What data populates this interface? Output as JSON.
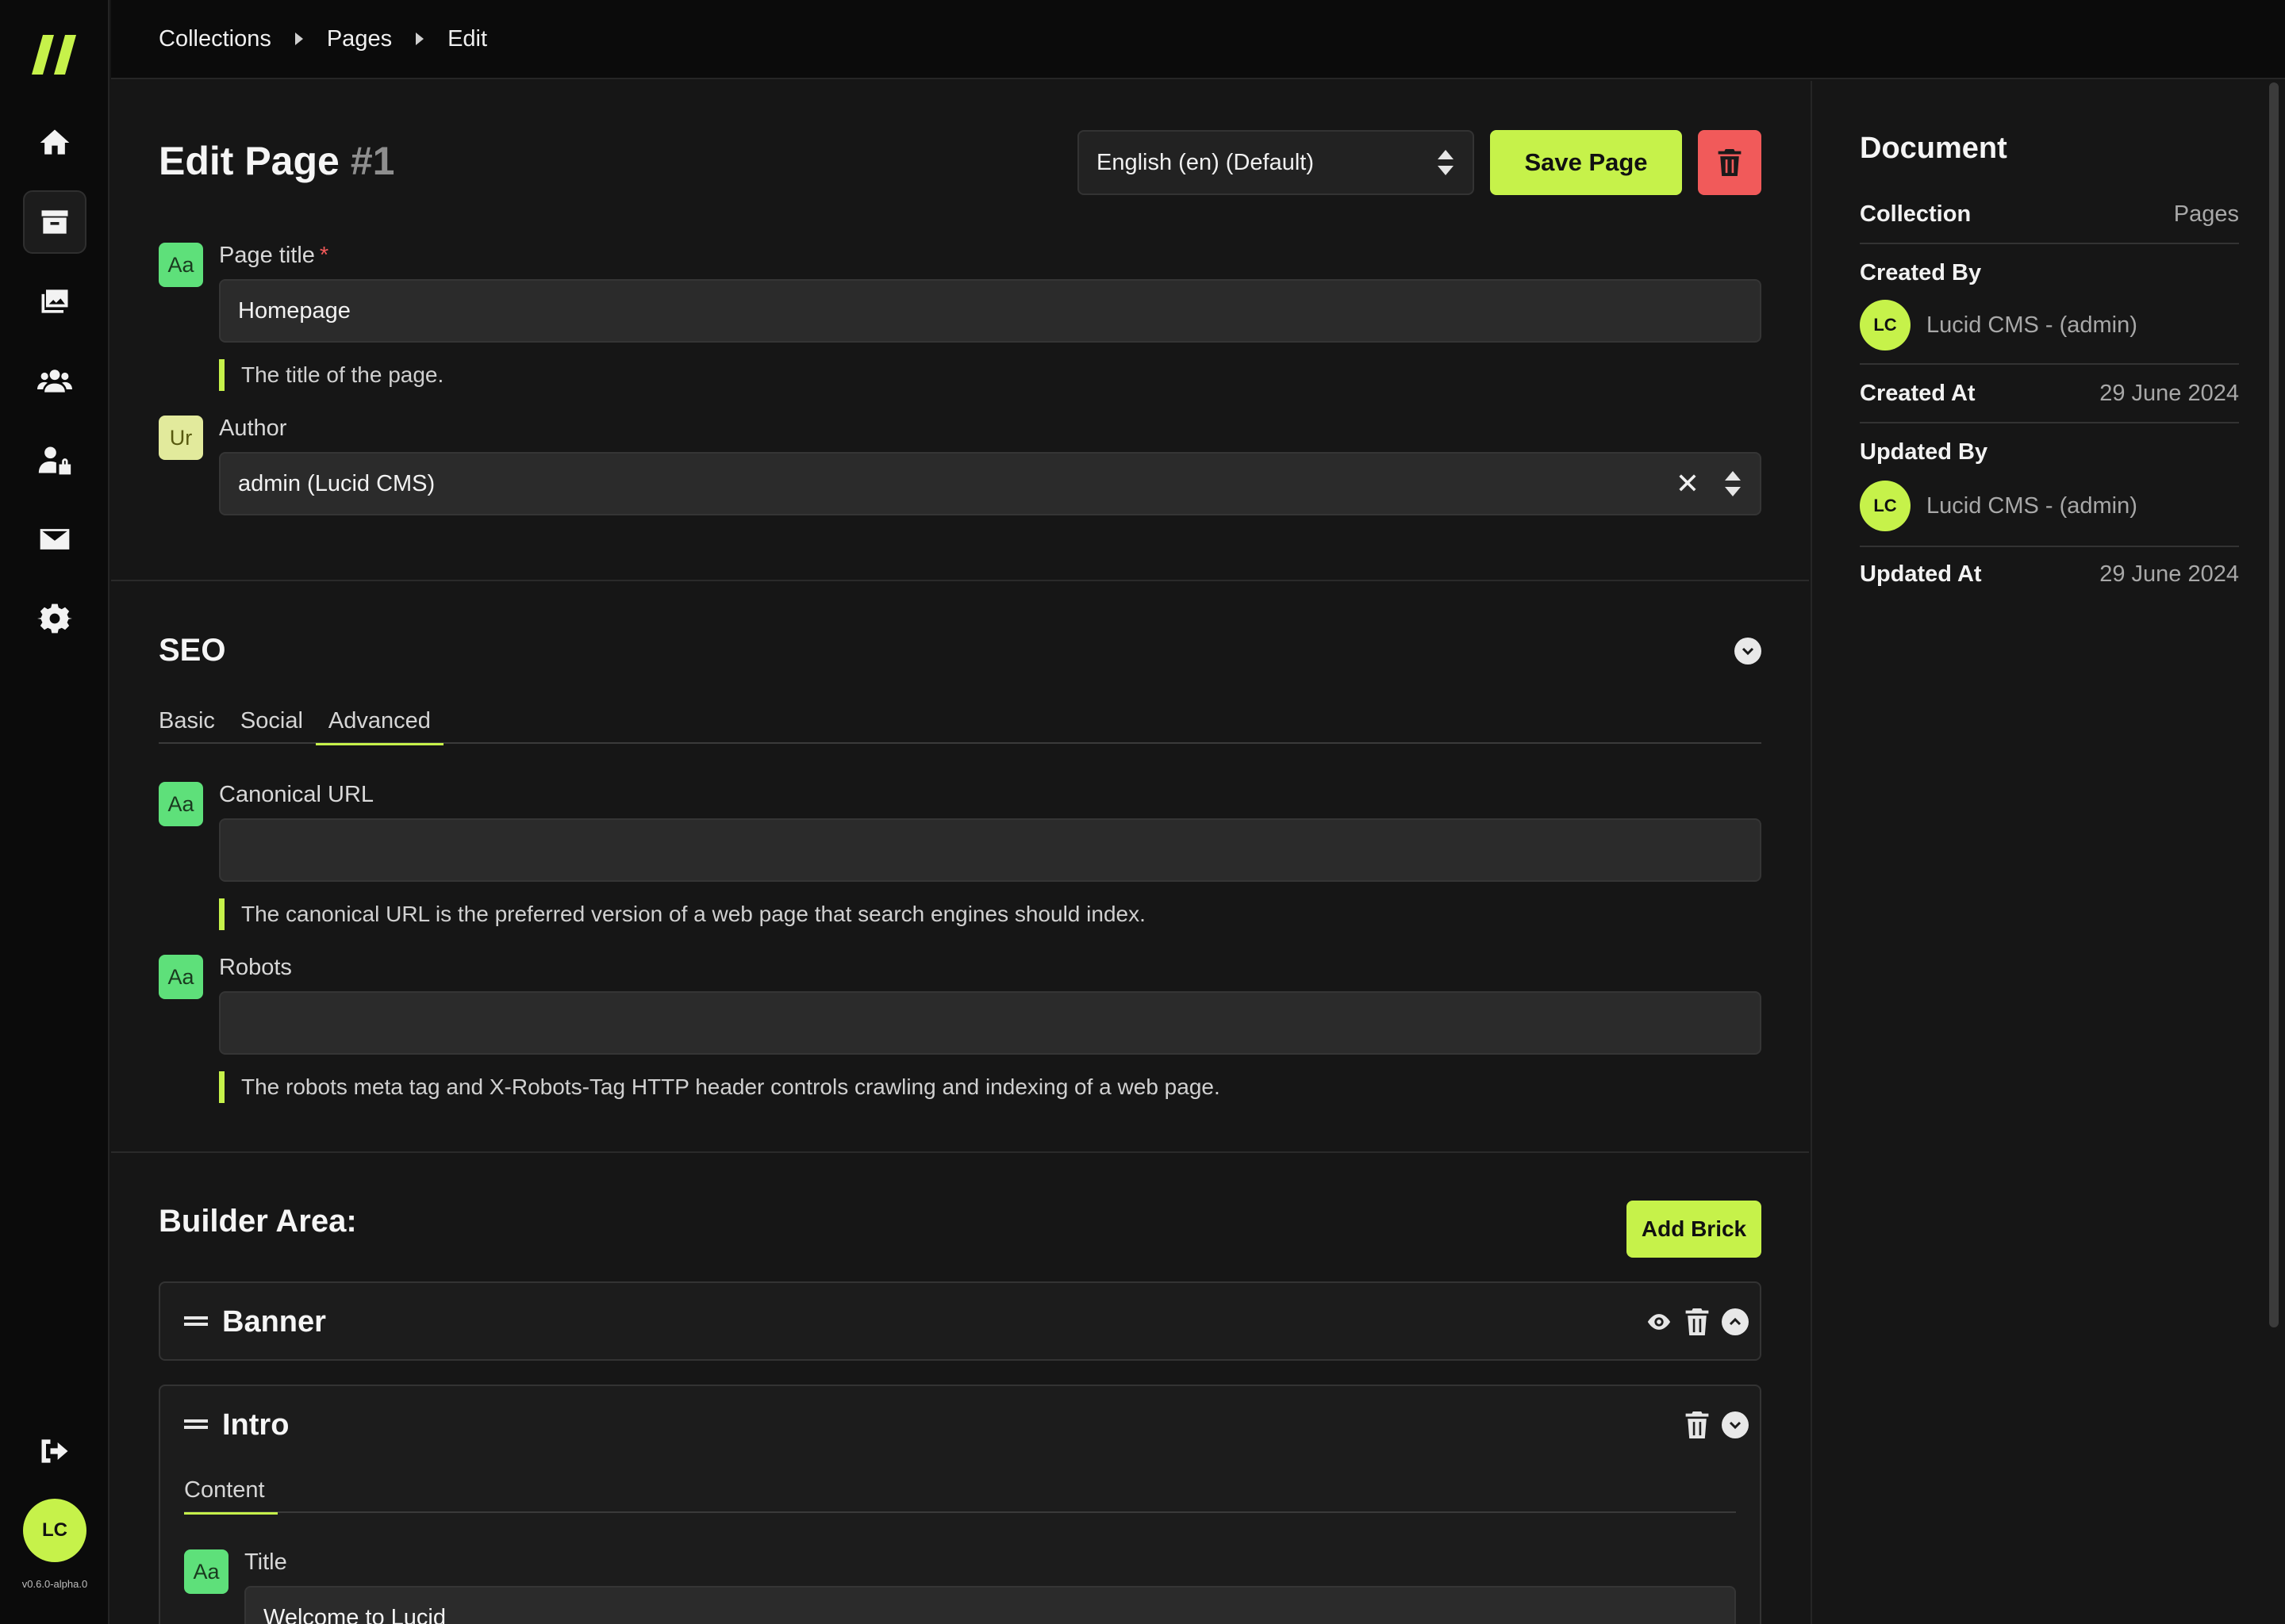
{
  "breadcrumb": [
    "Collections",
    "Pages",
    "Edit"
  ],
  "header": {
    "title": "Edit Page",
    "id_label": "#1",
    "language": "English (en) (Default)",
    "save_label": "Save Page"
  },
  "fields": {
    "page_title": {
      "label": "Page title",
      "required": "*",
      "badge": "Aa",
      "value": "Homepage",
      "help": "The title of the page."
    },
    "author": {
      "label": "Author",
      "badge": "Ur",
      "value": "admin (Lucid CMS)",
      "clear": "✕"
    }
  },
  "seo": {
    "title": "SEO",
    "tabs": [
      "Basic",
      "Social",
      "Advanced"
    ],
    "active_tab": "Advanced",
    "canonical": {
      "label": "Canonical URL",
      "badge": "Aa",
      "value": "",
      "help": "The canonical URL is the preferred version of a web page that search engines should index."
    },
    "robots": {
      "label": "Robots",
      "badge": "Aa",
      "value": "",
      "help": "The robots meta tag and X-Robots-Tag HTTP header controls crawling and indexing of a web page."
    }
  },
  "builder": {
    "title": "Builder Area:",
    "add_label": "Add Brick",
    "bricks": [
      {
        "name": "Banner"
      },
      {
        "name": "Intro",
        "tab": "Content",
        "field_label": "Title",
        "badge": "Aa",
        "value": "Welcome to Lucid"
      }
    ]
  },
  "document": {
    "title": "Document",
    "collection_key": "Collection",
    "collection_value": "Pages",
    "created_by_key": "Created By",
    "created_by_initials": "LC",
    "created_by_name": "Lucid CMS - (admin)",
    "created_at_key": "Created At",
    "created_at_value": "29 June 2024",
    "updated_by_key": "Updated By",
    "updated_by_initials": "LC",
    "updated_by_name": "Lucid CMS - (admin)",
    "updated_at_key": "Updated At",
    "updated_at_value": "29 June 2024"
  },
  "user": {
    "initials": "LC",
    "version": "v0.6.0-alpha.0"
  },
  "colors": {
    "accent": "#c6f24a",
    "danger": "#f15a5a",
    "badge_green": "#5ee07a",
    "badge_yellow": "#e2ea9c"
  },
  "icons": [
    "logo-icon",
    "home-icon",
    "collections-icon",
    "media-icon",
    "users-icon",
    "roles-icon",
    "email-icon",
    "settings-icon",
    "logout-icon",
    "trash-icon",
    "eye-icon",
    "chevron-up-icon",
    "chevron-down-icon",
    "drag-handle-icon"
  ]
}
